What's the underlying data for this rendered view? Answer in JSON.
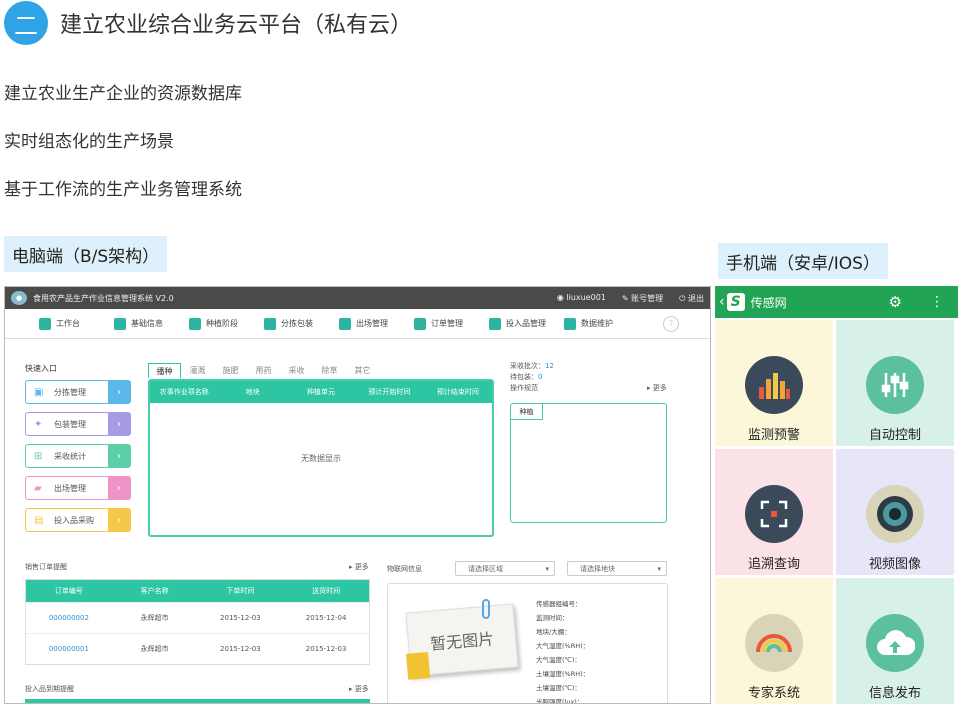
{
  "section": {
    "number": "二",
    "title": "建立农业综合业务云平台（私有云）"
  },
  "bullets": [
    "建立农业生产企业的资源数据库",
    "实时组态化的生产场景",
    "基于工作流的生产业务管理系统"
  ],
  "labels": {
    "pc": "电脑端（B/S架构）",
    "mobile": "手机端（安卓/IOS）"
  },
  "pc": {
    "app_title": "食用农产品生产作业信息管理系统 V2.0",
    "user": "liuxue001",
    "account": "账号管理",
    "logout": "退出",
    "nav": [
      "工作台",
      "基础信息",
      "种植阶段",
      "分拣包装",
      "出场管理",
      "订单管理",
      "投入品管理",
      "数据维护"
    ],
    "quick_title": "快速入口",
    "quick": [
      {
        "label": "分拣管理",
        "color": "#5bb8e8",
        "icon": "basket-icon"
      },
      {
        "label": "包装管理",
        "color": "#a79be6",
        "icon": "pin-icon"
      },
      {
        "label": "采收统计",
        "color": "#5dcfa8",
        "icon": "cart-icon"
      },
      {
        "label": "出场管理",
        "color": "#ef94c8",
        "icon": "truck-icon"
      },
      {
        "label": "投入品采购",
        "color": "#f5c84a",
        "icon": "box-icon"
      }
    ],
    "tabs": [
      "播种",
      "灌溉",
      "施肥",
      "用药",
      "采收",
      "除草",
      "其它"
    ],
    "task_headers": [
      "农事作业项名称",
      "地块",
      "种植单元",
      "预计开始时间",
      "预计结束时间"
    ],
    "no_data": "无数据显示",
    "harvest_batch_label": "采收批次：",
    "harvest_batch": "12",
    "pending_label": "待包装：",
    "pending": "0",
    "op_spec": "操作规范",
    "more": "更多",
    "plant_tab": "种植",
    "sales_title": "销售订单提醒",
    "sales_headers": [
      "订单编号",
      "客户名称",
      "下单时间",
      "送货时间"
    ],
    "sales_rows": [
      [
        "000000002",
        "永辉超市",
        "2015-12-03",
        "2015-12-04"
      ],
      [
        "000000001",
        "永辉超市",
        "2015-12-03",
        "2015-12-03"
      ]
    ],
    "iot_title": "物联网信息",
    "select_area": "请选择区域",
    "select_plot": "请选择地块",
    "no_image": "暂无图片",
    "iot_fields": [
      "传感器组编号：",
      "监测时间：",
      "地块/大棚：",
      "大气湿度(%RH)：",
      "大气温度(℃)：",
      "土壤湿度(%RH)：",
      "土壤温度(℃)：",
      "光照强度(lux)："
    ],
    "input_title": "投入品到期提醒"
  },
  "mobile": {
    "app_name": "传感网",
    "logo_letter": "S",
    "tiles": [
      {
        "label": "监测预警",
        "bg": "#fbf7d8",
        "icon": "equalizer-icon"
      },
      {
        "label": "自动控制",
        "bg": "#d7f1e8",
        "icon": "sliders-icon"
      },
      {
        "label": "追溯查询",
        "bg": "#fbe2e6",
        "icon": "scan-icon"
      },
      {
        "label": "视频图像",
        "bg": "#e7e6f8",
        "icon": "camera-icon"
      },
      {
        "label": "专家系统",
        "bg": "#fbf7d8",
        "icon": "rainbow-icon"
      },
      {
        "label": "信息发布",
        "bg": "#d7f1e8",
        "icon": "cloud-upload-icon"
      }
    ]
  }
}
